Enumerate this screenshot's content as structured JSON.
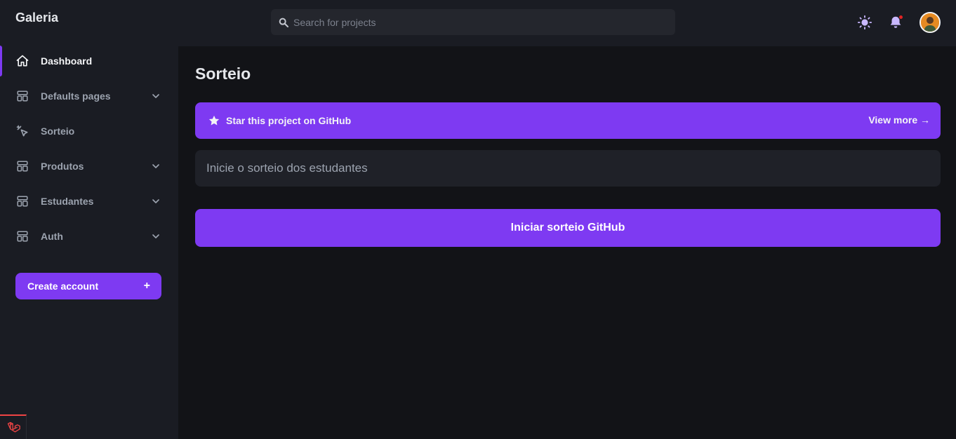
{
  "app": {
    "brand": "Galeria"
  },
  "header": {
    "search_placeholder": "Search for projects"
  },
  "sidebar": {
    "items": [
      {
        "label": "Dashboard",
        "icon": "home-icon",
        "active": true,
        "expandable": false
      },
      {
        "label": "Defaults pages",
        "icon": "layout-icon",
        "active": false,
        "expandable": true
      },
      {
        "label": "Sorteio",
        "icon": "cursor-click-icon",
        "active": false,
        "expandable": false
      },
      {
        "label": "Produtos",
        "icon": "layout-icon",
        "active": false,
        "expandable": true
      },
      {
        "label": "Estudantes",
        "icon": "layout-icon",
        "active": false,
        "expandable": true
      },
      {
        "label": "Auth",
        "icon": "layout-icon",
        "active": false,
        "expandable": true
      }
    ],
    "create_button": {
      "label": "Create account",
      "plus": "+"
    }
  },
  "main": {
    "title": "Sorteio",
    "banner": {
      "label": "Star this project on GitHub",
      "more": "View more →"
    },
    "info_text": "Inicie o sorteio dos estudantes",
    "action_button": "Iniciar sorteio GitHub"
  },
  "colors": {
    "accent": "#7e3af2",
    "sidebar_bg": "#1a1c23",
    "page_bg": "#121317",
    "notification": "#e02424"
  }
}
